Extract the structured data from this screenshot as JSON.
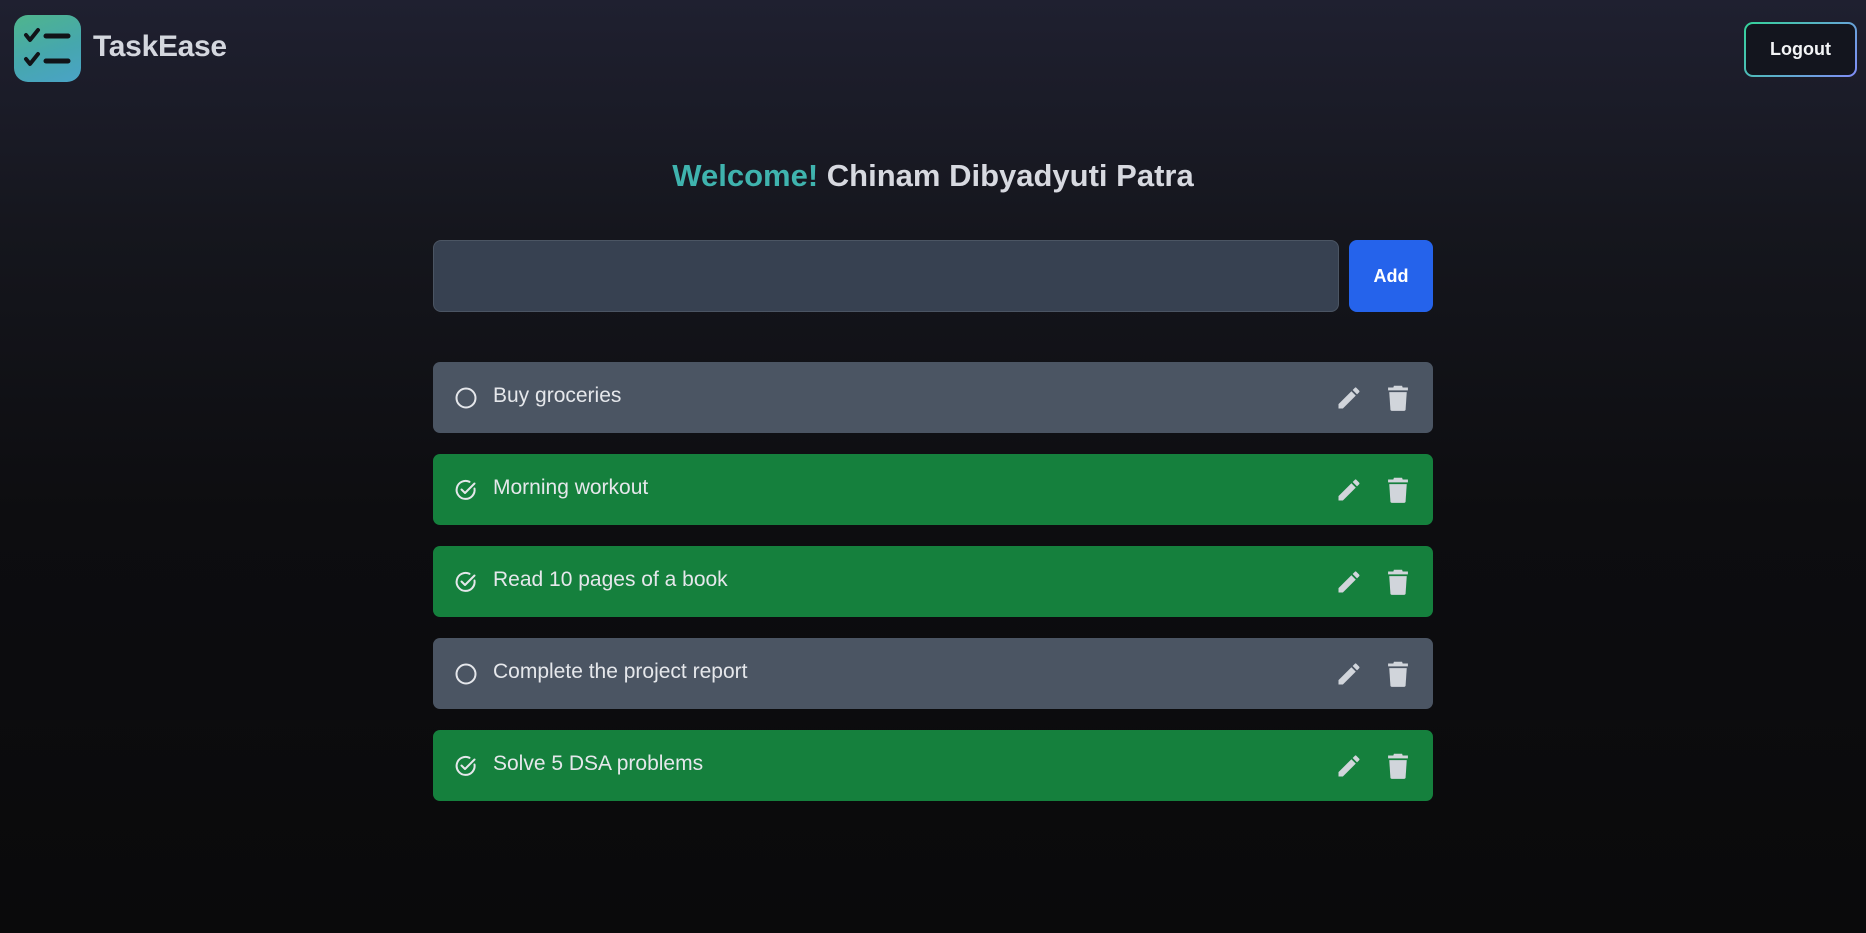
{
  "app": {
    "brand": "TaskEase",
    "logout_label": "Logout"
  },
  "welcome": {
    "greeting": "Welcome!",
    "user_name": "Chinam Dibyadyuti Patra"
  },
  "add_task": {
    "input_value": "",
    "button_label": "Add"
  },
  "colors": {
    "pending_bg": "#4b5563",
    "done_bg": "#15803d",
    "accent": "#3fb3ae",
    "add_button": "#2563eb"
  },
  "tasks": [
    {
      "text": "Buy groceries",
      "completed": false,
      "status_icon": "circle-icon"
    },
    {
      "text": "Morning workout",
      "completed": true,
      "status_icon": "check-circle-icon"
    },
    {
      "text": "Read 10 pages of a book",
      "completed": true,
      "status_icon": "check-circle-icon"
    },
    {
      "text": "Complete the project report",
      "completed": false,
      "status_icon": "circle-icon"
    },
    {
      "text": "Solve 5 DSA problems",
      "completed": true,
      "status_icon": "check-circle-icon"
    }
  ]
}
